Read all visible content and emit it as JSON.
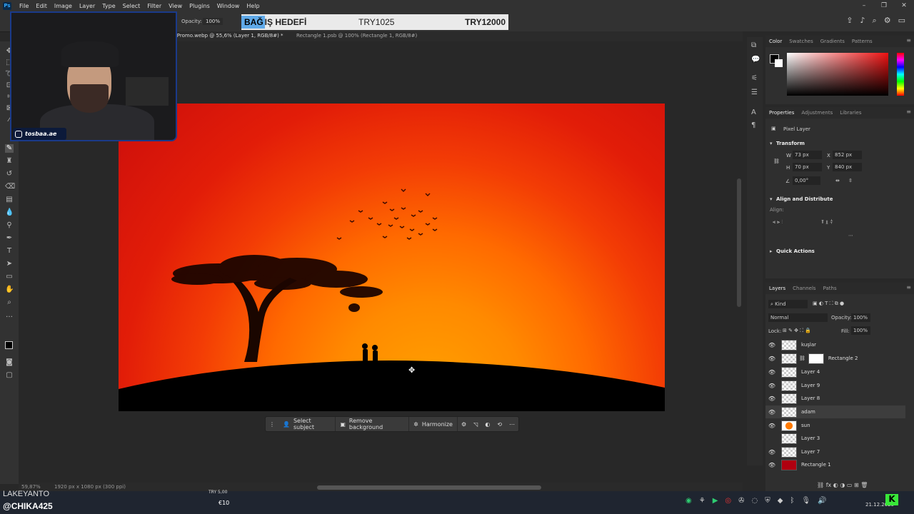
{
  "menu": [
    "File",
    "Edit",
    "Image",
    "Layer",
    "Type",
    "Select",
    "Filter",
    "View",
    "Plugins",
    "Window",
    "Help"
  ],
  "app_logo": "Ps",
  "options": {
    "opacity_label": "Opacity:",
    "opacity_value": "100%"
  },
  "donation": {
    "title_a": "BAĞ",
    "title_b": "IŞ HEDEFİ",
    "current": "TRY1025",
    "goal": "TRY12000"
  },
  "tabs": [
    "o_Promo.webp @ 55,6% (Layer 1, RGB/8#) *",
    "Rectangle 1.psb @ 100% (Rectangle 1, RGB/8#)"
  ],
  "webcam": {
    "instagram_handle": "tosbaa.ae"
  },
  "context_bar": {
    "select_subject": "Select subject",
    "remove_background": "Remove background",
    "harmonize": "Harmonize"
  },
  "status": {
    "zoom": "59,87%",
    "doc_size": "1920 px x 1080 px (300 ppi)"
  },
  "color_panel": {
    "tabs": [
      "Color",
      "Swatches",
      "Gradients",
      "Patterns"
    ]
  },
  "properties_panel": {
    "tabs": [
      "Properties",
      "Adjustments",
      "Libraries"
    ],
    "kind": "Pixel Layer",
    "transform_label": "Transform",
    "w_label": "W",
    "w": "73 px",
    "x_label": "X",
    "x": "852 px",
    "h_label": "H",
    "h": "70 px",
    "y_label": "Y",
    "y": "840 px",
    "angle": "0,00°",
    "align_label": "Align and Distribute",
    "align_sub": "Align:",
    "quick_actions": "Quick Actions"
  },
  "layers_panel": {
    "tabs": [
      "Layers",
      "Channels",
      "Paths"
    ],
    "kind_filter": "Kind",
    "blend_mode": "Normal",
    "opacity_label": "Opacity:",
    "opacity": "100%",
    "lock_label": "Lock:",
    "fill_label": "Fill:",
    "fill": "100%",
    "layers": [
      {
        "name": "kuşlar",
        "visible": true
      },
      {
        "name": "Rectangle 2",
        "visible": true
      },
      {
        "name": "Layer 4",
        "visible": true
      },
      {
        "name": "Layer 9",
        "visible": true
      },
      {
        "name": "Layer 8",
        "visible": true
      },
      {
        "name": "adam",
        "visible": true,
        "selected": true
      },
      {
        "name": "sun",
        "visible": true
      },
      {
        "name": "Layer 3",
        "visible": false
      },
      {
        "name": "Layer 7",
        "visible": true
      },
      {
        "name": "Rectangle 1",
        "visible": true
      }
    ]
  },
  "overlay": {
    "name": "LAKEYANTO",
    "handle": "@CHIKA425",
    "try_badge": "TRY 5,00",
    "eur_badge": "€10"
  },
  "clock": {
    "date": "21.12.2025"
  },
  "colors": {
    "accent": "#31a8ff",
    "sky_top": "#cc0e0c",
    "sun": "#ffa100",
    "silhouette": "#000000"
  }
}
